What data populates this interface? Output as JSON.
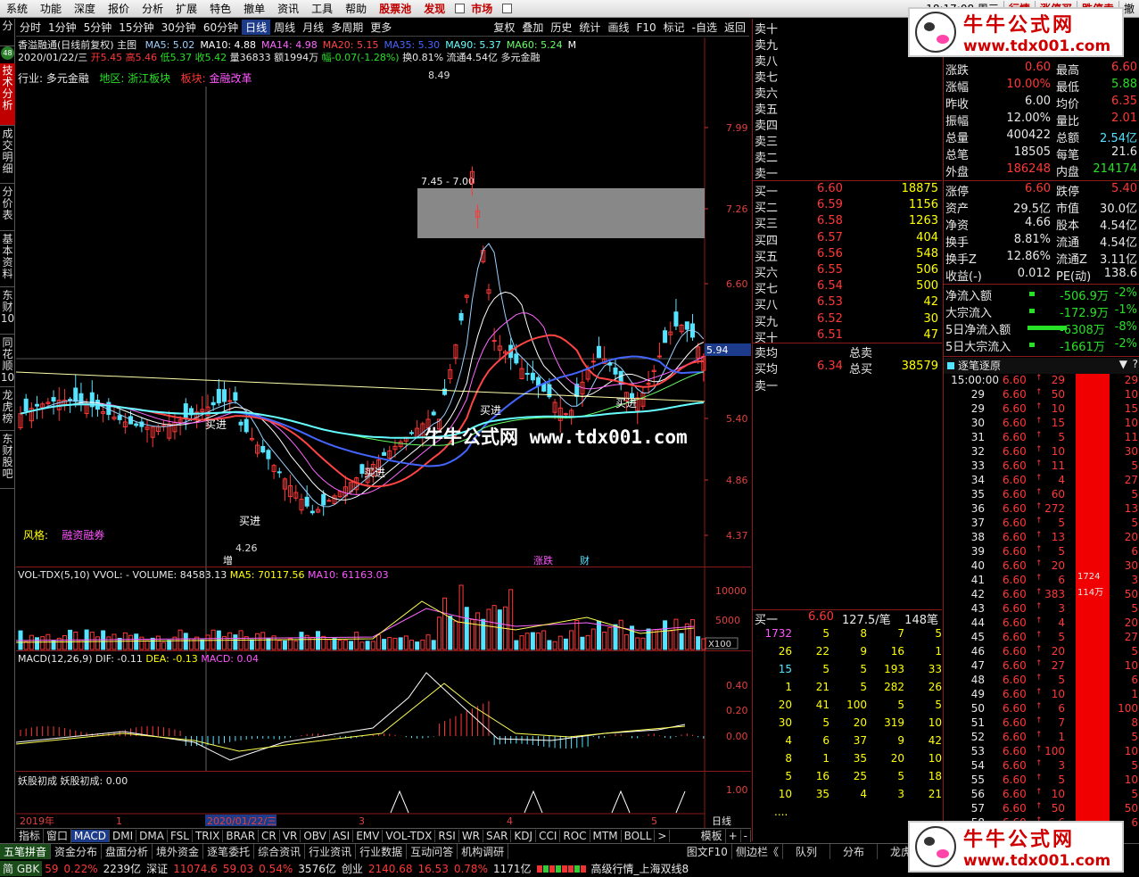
{
  "menubar": {
    "items": [
      "系统",
      "功能",
      "深度",
      "报价",
      "分析",
      "扩展",
      "特色",
      "撤单",
      "资讯",
      "工具",
      "帮助"
    ],
    "stock_pool": "股票池",
    "discover": "发现",
    "market": "市场",
    "time": "18:17:08 周三",
    "right": [
      "行情",
      "涨停买",
      "跌停卖",
      "撤"
    ]
  },
  "toolbar": {
    "periods": [
      "分时",
      "1分钟",
      "5分钟",
      "15分钟",
      "30分钟",
      "60分钟",
      "日线",
      "周线",
      "月线",
      "多周期",
      "更多"
    ],
    "right": [
      "复权",
      "叠加",
      "历史",
      "统计",
      "画线",
      "F10",
      "标记",
      "-自选",
      "返回"
    ]
  },
  "lefttabs": [
    "技术分析",
    "成交明细",
    "分价表",
    "基本资料",
    "东财10",
    "同花顺10",
    "龙虎榜",
    "东财股吧"
  ],
  "badge": "48",
  "chart": {
    "title": "香溢融通(日线前复权)",
    "main_label": "主图",
    "ma": [
      {
        "l": "MA5: 5.02",
        "c": "#9ad0ff"
      },
      {
        "l": "MA10: 4.88",
        "c": "#ffffff"
      },
      {
        "l": "MA14: 4.98",
        "c": "#ff66ff"
      },
      {
        "l": "MA20: 5.15",
        "c": "#ff4444"
      },
      {
        "l": "MA35: 5.30",
        "c": "#4466ff"
      },
      {
        "l": "MA90: 5.37",
        "c": "#66ffff"
      },
      {
        "l": "MA60: 5.24",
        "c": "#66ff66"
      },
      {
        "l": "M",
        "c": "#ffffff"
      }
    ],
    "info_date": "2020/01/22/三",
    "info_open": "开5.45",
    "info_high": "高5.46",
    "info_low": "低5.37",
    "info_close": "收5.42",
    "info_vol": "量36833",
    "info_amt": "额1994万",
    "info_pct": "幅-0.07(-1.28%)",
    "info_turn": "换0.81%",
    "info_float": "流通4.54亿",
    "info_sector": "多元金融",
    "industry": "行业: 多元金融",
    "region": "地区: 浙江板块",
    "block_label": "板块:",
    "block": "金融改革",
    "style_label": "风格:",
    "style": "融资融券",
    "yticks": [
      "7.99",
      "7.26",
      "6.60",
      "5.40",
      "4.86",
      "4.37"
    ],
    "price_tag": "5.94",
    "gap_label": "7.45 - 7.00",
    "high_label": "8.49",
    "low_label": "4.26",
    "buy_labels": [
      "买进",
      "买进",
      "买进",
      "买进",
      "买进"
    ],
    "markers": [
      "增",
      "涨跌",
      "财"
    ],
    "vol_title": "VOL-TDX(5,10)  VVOL: -  VOLUME: 84583.13",
    "vol_ma5": "MA5: 70117.56",
    "vol_ma10": "MA10: 61163.03",
    "vol_ticks": [
      "10000",
      "5000"
    ],
    "vol_unit": "X100",
    "macd_title": "MACD(12,26,9)  DIF: -0.11",
    "macd_dea": "DEA: -0.13",
    "macd_val": "MACD: 0.04",
    "macd_ticks": [
      "0.40",
      "0.20",
      "0.00"
    ],
    "ygcc_title": "妖股初成  妖股初成: 0.00",
    "ygcc_tick": "1.00",
    "xaxis": [
      "2019年",
      "1",
      "2020/01/22/三",
      "3",
      "4",
      "5"
    ],
    "period_label": "日线"
  },
  "orderbook": {
    "sells": [
      "卖十",
      "卖九",
      "卖八",
      "卖七",
      "卖六",
      "卖五",
      "卖四",
      "卖三",
      "卖二",
      "卖一"
    ],
    "buys": [
      {
        "l": "买一",
        "p": "6.60",
        "v": "18875"
      },
      {
        "l": "买二",
        "p": "6.59",
        "v": "1156"
      },
      {
        "l": "买三",
        "p": "6.58",
        "v": "1263"
      },
      {
        "l": "买四",
        "p": "6.57",
        "v": "404"
      },
      {
        "l": "买五",
        "p": "6.56",
        "v": "548"
      },
      {
        "l": "买六",
        "p": "6.55",
        "v": "506"
      },
      {
        "l": "买七",
        "p": "6.54",
        "v": "500"
      },
      {
        "l": "买八",
        "p": "6.53",
        "v": "42"
      },
      {
        "l": "买九",
        "p": "6.52",
        "v": "30"
      },
      {
        "l": "买十",
        "p": "6.51",
        "v": "47"
      }
    ],
    "avg_sell": "卖均",
    "avg_sell_total": "总卖",
    "avg_buy": "买均",
    "avg_buy_price": "6.34",
    "avg_buy_total_label": "总买",
    "avg_buy_total": "38579",
    "sell1_bottom": "卖一",
    "queue_head": {
      "l": "买一",
      "p": "6.60",
      "per": "127.5/笔",
      "n": "148笔"
    },
    "queue": [
      [
        "1732",
        "5",
        "8",
        "7",
        "5"
      ],
      [
        "26",
        "22",
        "9",
        "16",
        "1"
      ],
      [
        "15",
        "5",
        "5",
        "193",
        "33"
      ],
      [
        "1",
        "21",
        "5",
        "282",
        "26"
      ],
      [
        "20",
        "41",
        "100",
        "5",
        "5"
      ],
      [
        "30",
        "5",
        "20",
        "319",
        "10"
      ],
      [
        "4",
        "6",
        "37",
        "9",
        "42"
      ],
      [
        "8",
        "1",
        "35",
        "20",
        "10"
      ],
      [
        "5",
        "16",
        "25",
        "5",
        "18"
      ],
      [
        "10",
        "35",
        "4",
        "3",
        "21"
      ]
    ],
    "more": "...."
  },
  "quote": {
    "rows": [
      [
        "涨跌",
        "0.60",
        "最高",
        "6.60"
      ],
      [
        "涨幅",
        "10.00%",
        "最低",
        "5.88"
      ],
      [
        "昨收",
        "6.00",
        "均价",
        "6.35"
      ],
      [
        "振幅",
        "12.00%",
        "量比",
        "2.01"
      ],
      [
        "总量",
        "400422",
        "总额",
        "2.54亿"
      ],
      [
        "总笔",
        "18505",
        "每笔",
        "21.6"
      ],
      [
        "外盘",
        "186248",
        "内盘",
        "214174"
      ],
      [
        "涨停",
        "6.60",
        "跌停",
        "5.40"
      ],
      [
        "资产",
        "29.5亿",
        "市值",
        "30.0亿"
      ],
      [
        "净资",
        "4.66",
        "股本",
        "4.54亿"
      ],
      [
        "换手",
        "8.81%",
        "流通",
        "4.54亿"
      ],
      [
        "换手Z",
        "12.86%",
        "流通Z",
        "3.11亿"
      ],
      [
        "收益(-)",
        "0.012",
        "PE(动)",
        "138.6"
      ]
    ],
    "flows": [
      [
        "净流入额",
        "-506.9万",
        "-2%"
      ],
      [
        "大宗流入",
        "-172.9万",
        "-1%"
      ],
      [
        "5日净流入额",
        "-6308万",
        "-8%"
      ],
      [
        "5日大宗流入",
        "-1661万",
        "-2%"
      ]
    ],
    "ticks_title": "逐笔逐原",
    "ticks": [
      [
        "15:00:00",
        "6.60",
        "29"
      ],
      [
        "29",
        "6.60",
        "50"
      ],
      [
        "29",
        "6.60",
        "10"
      ],
      [
        "30",
        "6.60",
        "15"
      ],
      [
        "31",
        "6.60",
        "5"
      ],
      [
        "32",
        "6.60",
        "10"
      ],
      [
        "33",
        "6.60",
        "11"
      ],
      [
        "34",
        "6.60",
        "4"
      ],
      [
        "35",
        "6.60",
        "60"
      ],
      [
        "36",
        "6.60",
        "272"
      ],
      [
        "37",
        "6.60",
        "5"
      ],
      [
        "38",
        "6.60",
        "13"
      ],
      [
        "39",
        "6.60",
        "5"
      ],
      [
        "40",
        "6.60",
        "20"
      ],
      [
        "41",
        "6.60",
        "6"
      ],
      [
        "42",
        "6.60",
        "383"
      ],
      [
        "43",
        "6.60",
        "3"
      ],
      [
        "44",
        "6.60",
        "4"
      ],
      [
        "45",
        "6.60",
        "5"
      ],
      [
        "46",
        "6.60",
        "20"
      ],
      [
        "47",
        "6.60",
        "27"
      ],
      [
        "48",
        "6.60",
        "5"
      ],
      [
        "49",
        "6.60",
        "10"
      ],
      [
        "50",
        "6.60",
        "6"
      ],
      [
        "51",
        "6.60",
        "7"
      ],
      [
        "52",
        "6.60",
        "1"
      ],
      [
        "53",
        "6.60",
        "100"
      ],
      [
        "54",
        "6.60",
        "3"
      ],
      [
        "55",
        "6.60",
        "5"
      ],
      [
        "56",
        "6.60",
        "10"
      ],
      [
        "57",
        "6.60",
        "50"
      ],
      [
        "58",
        "6.60",
        "6"
      ]
    ],
    "bar_label1": "1724",
    "bar_label2": "114万",
    "right_col": [
      "29",
      "10",
      "15",
      "10",
      "11",
      "30",
      "5",
      "27",
      "5",
      "13",
      "5",
      "20",
      "6",
      "30",
      "3",
      "50",
      "5",
      "20",
      "27",
      "5",
      "10",
      "6",
      "1",
      "100",
      "8",
      "5",
      "10",
      "5",
      "10",
      "5",
      "50",
      "6"
    ]
  },
  "bottombar": {
    "items": [
      "指标",
      "窗口",
      "MACD",
      "DMI",
      "DMA",
      "FSL",
      "TRIX",
      "BRAR",
      "CR",
      "VR",
      "OBV",
      "ASI",
      "EMV",
      "VOL-TDX",
      "RSI",
      "WR",
      "SAR",
      "KDJ",
      "CCI",
      "ROC",
      "MTM",
      "BOLL"
    ],
    "right": [
      "模板",
      "+",
      "-"
    ]
  },
  "bottom2": {
    "ime": "五笔拼音",
    "items": [
      "资金分布",
      "盘面分析",
      "境外资金",
      "逐笔委托",
      "综合资讯",
      "行业资讯",
      "行业数据",
      "互动问答",
      "机构调研"
    ],
    "right": [
      "图文F10",
      "侧边栏《",
      "队列",
      "分布",
      "龙虎"
    ]
  },
  "status": {
    "ime": "简 GBK",
    "v1": "59",
    "v2": "0.22%",
    "v3": "2239亿",
    "sz": "深证",
    "sz1": "11074.6",
    "sz2": "59.03",
    "sz3": "0.54%",
    "sz4": "3576亿",
    "cy": "创业",
    "cy1": "2140.68",
    "cy2": "16.53",
    "cy3": "0.78%",
    "cy4": "1171亿",
    "right": "高级行情_上海双线8"
  },
  "watermark": {
    "cn": "牛牛公式网",
    "url": "www.tdx001.com",
    "center": "牛牛公式网  www.tdx001.com"
  }
}
